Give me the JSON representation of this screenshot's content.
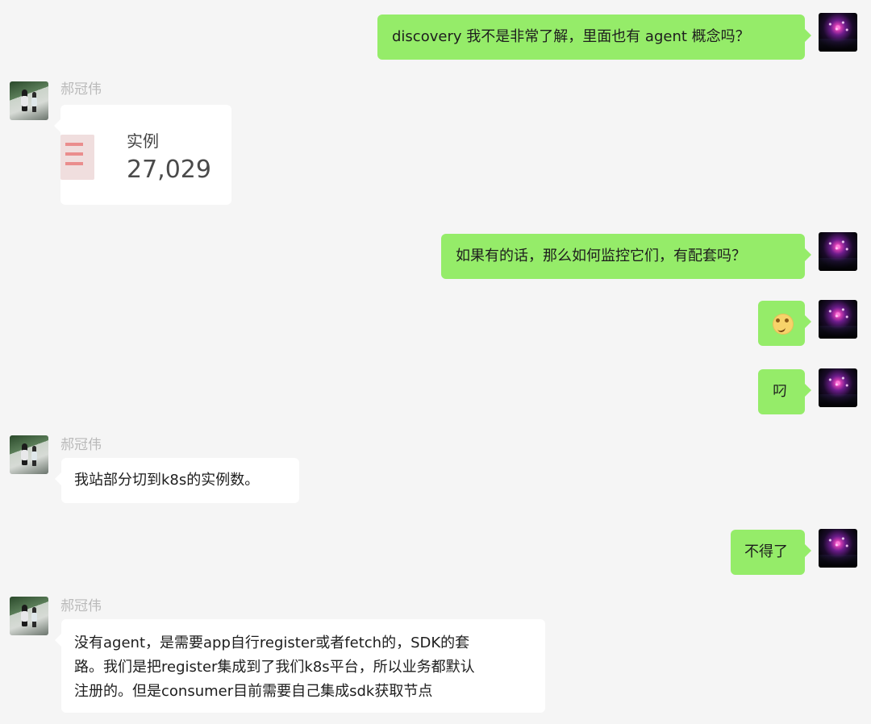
{
  "messages": [
    {
      "text": "discovery 我不是非常了解，里面也有 agent 概念吗？"
    },
    {
      "sender": "郝冠伟",
      "card": {
        "label": "实例",
        "value": "27,029"
      }
    },
    {
      "text": "如果有的话，那么如何监控它们，有配套吗？"
    },
    {
      "emoji": "thinking-face"
    },
    {
      "text": "叼"
    },
    {
      "sender": "郝冠伟",
      "text": "我站部分切到k8s的实例数。"
    },
    {
      "text": "不得了"
    },
    {
      "sender": "郝冠伟",
      "lines": [
        "没有agent，是需要app自行register或者fetch的，SDK的套",
        "路。我们是把register集成到了我们k8s平台，所以业务都默认",
        "注册的。但是consumer目前需要自己集成sdk获取节点"
      ]
    }
  ],
  "colors": {
    "background": "#f5f5f5",
    "outgoing_bubble": "#95ec69",
    "incoming_bubble": "#ffffff",
    "sender_name": "#b9b9b9"
  }
}
